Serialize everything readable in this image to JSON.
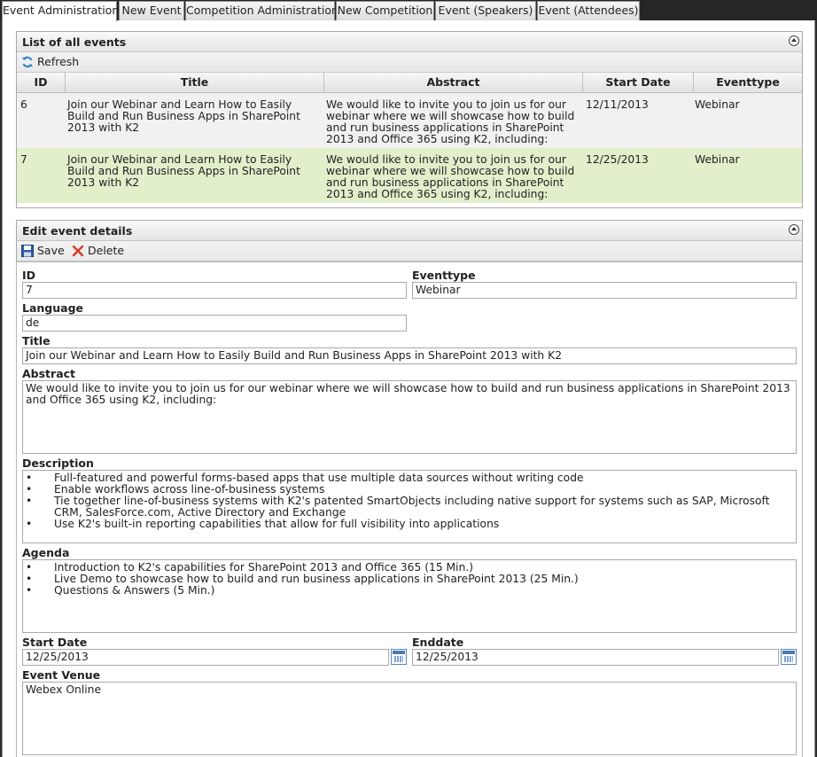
{
  "tabs": [
    "Event Administration",
    "New Event",
    "Competition Administration",
    "New Competition",
    "Event (Speakers)",
    "Event (Attendees)"
  ],
  "list_panel": {
    "title": "List of all events",
    "refresh_label": "Refresh",
    "columns": [
      "ID",
      "Title",
      "Abstract",
      "Start Date",
      "Eventtype"
    ],
    "rows": [
      {
        "id": "6",
        "title": "Join our Webinar and Learn How to Easily Build and Run Business Apps in SharePoint 2013 with K2",
        "abstract": "We would like to invite you to join us for our webinar where we will showcase how to build and run business applications in SharePoint 2013 and Office 365 using K2, including:",
        "start_date": "12/11/2013",
        "eventtype": "Webinar"
      },
      {
        "id": "7",
        "title": "Join our Webinar and Learn How to Easily Build and Run Business Apps in SharePoint 2013 with K2",
        "abstract": "We would like to invite you to join us for our webinar where we will showcase how to build and run business applications in SharePoint 2013 and Office 365 using K2, including:",
        "start_date": "12/25/2013",
        "eventtype": "Webinar"
      }
    ]
  },
  "edit_panel": {
    "title": "Edit event details",
    "save_label": "Save",
    "delete_label": "Delete"
  },
  "form": {
    "id_label": "ID",
    "id_value": "7",
    "eventtype_label": "Eventtype",
    "eventtype_value": "Webinar",
    "language_label": "Language",
    "language_value": "de",
    "title_label": "Title",
    "title_value": "Join our Webinar and Learn How to Easily Build and Run Business Apps in SharePoint 2013 with K2",
    "abstract_label": "Abstract",
    "abstract_value": "We would like to invite you to join us for our webinar where we will showcase how to build and run business applications in SharePoint 2013 and Office 365 using K2, including:",
    "description_label": "Description",
    "description_items": [
      "Full-featured and powerful forms-based apps that use multiple data sources without writing code",
      "Enable workflows across line-of-business systems",
      "Tie together line-of-business systems with K2's patented SmartObjects including native support for systems such as SAP, Microsoft CRM, SalesForce.com, Active Directory and Exchange",
      "Use K2's built-in reporting capabilities that allow for full visibility into applications"
    ],
    "agenda_label": "Agenda",
    "agenda_items": [
      "Introduction to K2's capabilities for SharePoint 2013 and Office 365 (15 Min.)",
      "Live Demo to showcase how to build and run business applications in SharePoint 2013 (25 Min.)",
      "Questions & Answers (5 Min.)"
    ],
    "start_date_label": "Start Date",
    "start_date_value": "12/25/2013",
    "enddate_label": "Enddate",
    "enddate_value": "12/25/2013",
    "venue_label": "Event Venue",
    "venue_value": "Webex Online"
  }
}
